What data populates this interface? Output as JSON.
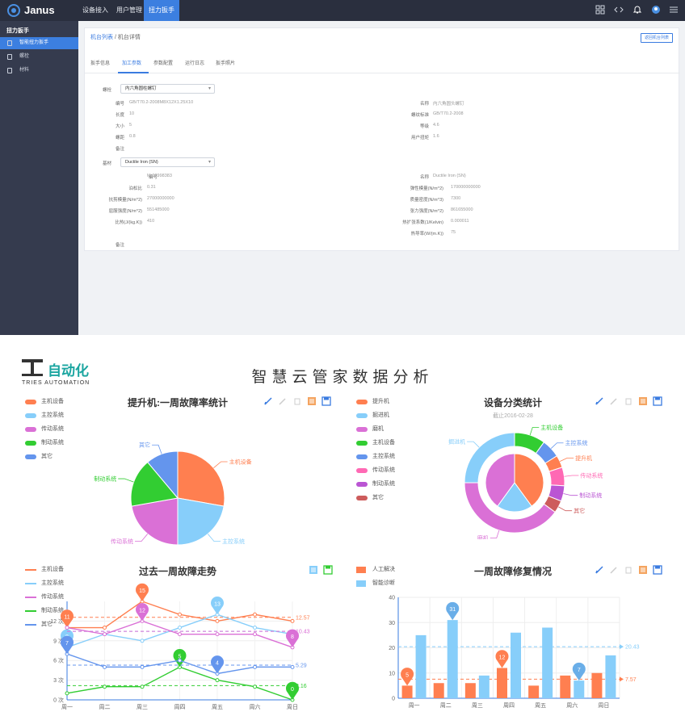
{
  "app": {
    "brand": "Janus",
    "nav": [
      "设备接入",
      "用户管理",
      "扭力扳手"
    ],
    "active_nav": 2
  },
  "sidebar": {
    "header": "扭力扳手",
    "items": [
      {
        "label": "智能扭力扳手",
        "active": true
      },
      {
        "label": "螺栓",
        "active": false
      },
      {
        "label": "材料",
        "active": false
      }
    ]
  },
  "detail": {
    "breadcrumb": [
      "机台列表",
      "机台详情"
    ],
    "back_button": "返回机台列表",
    "tabs": [
      "扳手信息",
      "加工参数",
      "参数配置",
      "运行日志",
      "扳手照片"
    ],
    "active_tab": 1,
    "bolt_label": "螺栓",
    "bolt_selected": "内六角圆柱螺钉",
    "bolt_fields": [
      {
        "label": "编号",
        "value": "GB/T70.2-2008M8X12X1.25X10"
      },
      {
        "label": "名称",
        "value": "内六角圆头螺钉"
      },
      {
        "label": "长度",
        "value": "10"
      },
      {
        "label": "螺纹标准",
        "value": "GB/T70.2-2008"
      },
      {
        "label": "大小",
        "value": "5"
      },
      {
        "label": "等级",
        "value": "4.6"
      },
      {
        "label": "螺距",
        "value": "0.8"
      },
      {
        "label": "用户扭矩",
        "value": "1.6"
      },
      {
        "label": "备注",
        "value": ""
      }
    ],
    "material_label": "基材",
    "material_selected": "Ductile Iron (SN)",
    "material_fields": [
      {
        "label": "编号",
        "value": "M-02998383"
      },
      {
        "label": "名称",
        "value": "Ductile Iron (SN)"
      },
      {
        "label": "泊松比",
        "value": "0.31"
      },
      {
        "label": "弹性模量(N/m^2)",
        "value": "170000000000"
      },
      {
        "label": "抗剪模量(N/m^2)",
        "value": "27000000000"
      },
      {
        "label": "质量密度(N/m^3)",
        "value": "7300"
      },
      {
        "label": "屈服强度(N/m^2)",
        "value": "551485000"
      },
      {
        "label": "张力强度(N/m^2)",
        "value": "861655000"
      },
      {
        "label": "比热(J/(kg.K))",
        "value": "410"
      },
      {
        "label": "热扩张系数(1/Kelvin)",
        "value": "0.000011"
      },
      {
        "label": "热导率(W/(m.K))",
        "value": "75"
      },
      {
        "label": "备注",
        "value": ""
      }
    ]
  },
  "dashboard": {
    "brand_text": "自动化",
    "brand_sub": "TRIES  AUTOMATION",
    "title": "智慧云管家数据分析",
    "colors": {
      "orange": "#ff7f50",
      "lightblue": "#87cefa",
      "purple": "#da70d6",
      "green": "#32cd32",
      "blue": "#6495ed",
      "pink": "#ff69b4",
      "violet": "#ba55d3",
      "red": "#cd5c5c"
    }
  },
  "chart_data": [
    {
      "type": "pie",
      "title": "提升机:一周故障率统计",
      "legend": [
        "主机设备",
        "主控系统",
        "传动系统",
        "制动系统",
        "其它"
      ],
      "values": [
        25,
        20,
        20,
        15,
        10
      ],
      "colors": [
        "#ff7f50",
        "#87cefa",
        "#da70d6",
        "#32cd32",
        "#6495ed"
      ]
    },
    {
      "type": "pie",
      "title": "设备分类统计",
      "subtitle": "截止2016-02-28",
      "legend": [
        "提升机",
        "掘进机",
        "磨机",
        "主机设备",
        "主控系统",
        "传动系统",
        "制动系统",
        "其它"
      ],
      "inner": {
        "labels": [
          "提升机",
          "掘进机",
          "磨机"
        ],
        "values": [
          40,
          20,
          40
        ],
        "colors": [
          "#ff7f50",
          "#87cefa",
          "#da70d6"
        ]
      },
      "outer": {
        "labels": [
          "主机设备",
          "主控系统",
          "提升机",
          "传动系统",
          "制动系统",
          "其它",
          "磨机",
          "掘进机"
        ],
        "values": [
          10,
          6,
          4,
          6,
          5,
          4,
          40,
          25
        ],
        "colors": [
          "#32cd32",
          "#6495ed",
          "#ff7f50",
          "#ff69b4",
          "#ba55d3",
          "#cd5c5c",
          "#da70d6",
          "#87cefa"
        ]
      }
    },
    {
      "type": "line",
      "title": "过去一周故障走势",
      "categories": [
        "周一",
        "周二",
        "周三",
        "周四",
        "周五",
        "周六",
        "周日"
      ],
      "ylim": [
        0,
        15
      ],
      "yticks": [
        "0 次",
        "3 次",
        "6 次",
        "9 次",
        "12 次"
      ],
      "series": [
        {
          "name": "主机设备",
          "values": [
            11,
            11,
            15,
            13,
            12,
            13,
            12
          ],
          "avg": 12.57,
          "color": "#ff7f50",
          "max_idx": 2,
          "min_idx": 0
        },
        {
          "name": "主控系统",
          "values": [
            8,
            10,
            9,
            11,
            13,
            11,
            10
          ],
          "avg": 10.43,
          "color": "#87cefa",
          "max_idx": 4,
          "min_idx": 0
        },
        {
          "name": "传动系统",
          "values": [
            11,
            10,
            12,
            10,
            10,
            10,
            8
          ],
          "avg": 10.43,
          "color": "#da70d6",
          "max_idx": 2,
          "min_idx": 6
        },
        {
          "name": "制动系统",
          "values": [
            1,
            2,
            2,
            5,
            3,
            2,
            0
          ],
          "avg": 2.16,
          "color": "#32cd32",
          "max_idx": 3,
          "min_idx": 6
        },
        {
          "name": "其它",
          "values": [
            7,
            5,
            5,
            6,
            4,
            5,
            5
          ],
          "avg": 5.29,
          "color": "#6495ed",
          "max_idx": 0,
          "min_idx": 4
        }
      ],
      "avg_labels": [
        "12.57",
        "10.43",
        "5.29",
        "2.16"
      ]
    },
    {
      "type": "bar",
      "title": "一周故障修复情况",
      "categories": [
        "周一",
        "周二",
        "周三",
        "周四",
        "周五",
        "周六",
        "周日"
      ],
      "ylim": [
        0,
        40
      ],
      "yticks": [
        "0",
        "10",
        "20",
        "30",
        "40"
      ],
      "series": [
        {
          "name": "人工解决",
          "values": [
            5,
            6,
            6,
            12,
            5,
            9,
            10
          ],
          "color": "#ff7f50",
          "avg": 7.57,
          "max_idx": 3,
          "min_idx": 0
        },
        {
          "name": "智能诊断",
          "values": [
            25,
            31,
            9,
            26,
            28,
            7,
            17
          ],
          "color": "#87cefa",
          "avg": 20.43,
          "max_idx": 1,
          "min_idx": 5
        }
      ],
      "avg_labels": [
        "20.43",
        "7.57"
      ]
    }
  ]
}
